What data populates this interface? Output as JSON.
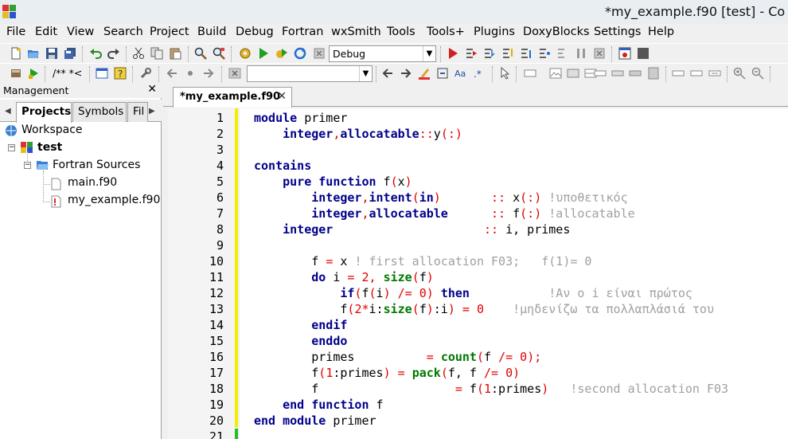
{
  "window": {
    "title": "*my_example.f90 [test] - Co"
  },
  "menu": [
    "File",
    "Edit",
    "View",
    "Search",
    "Project",
    "Build",
    "Debug",
    "Fortran",
    "wxSmith",
    "Tools",
    "Tools+",
    "Plugins",
    "DoxyBlocks",
    "Settings",
    "Help"
  ],
  "toolbar": {
    "build_target": "Debug",
    "doxy_comment_label": "/** *<",
    "search_value": ""
  },
  "management": {
    "title": "Management",
    "close": "✕",
    "tabs": [
      "Projects",
      "Symbols",
      "Fil"
    ],
    "tree": {
      "workspace": "Workspace",
      "project": "test",
      "folder": "Fortran Sources",
      "files": [
        "main.f90",
        "my_example.f90"
      ]
    }
  },
  "editor": {
    "tab_label": "*my_example.f90",
    "tab_close": "✕",
    "lines": [
      {
        "n": "1",
        "tokens": [
          [
            "kw",
            "module"
          ],
          [
            "id",
            " primer"
          ]
        ]
      },
      {
        "n": "2",
        "tokens": [
          [
            "id",
            "    "
          ],
          [
            "kw",
            "integer"
          ],
          [
            "op",
            ","
          ],
          [
            "kw",
            "allocatable"
          ],
          [
            "op",
            "::"
          ],
          [
            "id",
            "y"
          ],
          [
            "op",
            "(:)"
          ]
        ]
      },
      {
        "n": "3",
        "tokens": []
      },
      {
        "n": "4",
        "tokens": [
          [
            "kw",
            "contains"
          ]
        ]
      },
      {
        "n": "5",
        "tokens": [
          [
            "id",
            "    "
          ],
          [
            "kw",
            "pure function"
          ],
          [
            "id",
            " f"
          ],
          [
            "op",
            "("
          ],
          [
            "id",
            "x"
          ],
          [
            "op",
            ")"
          ]
        ]
      },
      {
        "n": "6",
        "tokens": [
          [
            "id",
            "        "
          ],
          [
            "kw",
            "integer"
          ],
          [
            "op",
            ","
          ],
          [
            "kw",
            "intent"
          ],
          [
            "op",
            "("
          ],
          [
            "kw",
            "in"
          ],
          [
            "op",
            ")"
          ],
          [
            "id",
            "       "
          ],
          [
            "op",
            "::"
          ],
          [
            "id",
            " x"
          ],
          [
            "op",
            "(:)"
          ],
          [
            "cm",
            " !υποθετικός"
          ]
        ]
      },
      {
        "n": "7",
        "tokens": [
          [
            "id",
            "        "
          ],
          [
            "kw",
            "integer"
          ],
          [
            "op",
            ","
          ],
          [
            "kw",
            "allocatable"
          ],
          [
            "id",
            "      "
          ],
          [
            "op",
            "::"
          ],
          [
            "id",
            " f"
          ],
          [
            "op",
            "(:)"
          ],
          [
            "cm",
            " !allocatable"
          ]
        ]
      },
      {
        "n": "8",
        "tokens": [
          [
            "id",
            "    "
          ],
          [
            "kw",
            "integer"
          ],
          [
            "id",
            "                     "
          ],
          [
            "op",
            "::"
          ],
          [
            "id",
            " i, primes"
          ]
        ]
      },
      {
        "n": "9",
        "tokens": []
      },
      {
        "n": "10",
        "tokens": [
          [
            "id",
            "        f "
          ],
          [
            "op",
            "="
          ],
          [
            "id",
            " x "
          ],
          [
            "cm",
            "! first allocation F03;   f(1)= 0"
          ]
        ]
      },
      {
        "n": "11",
        "tokens": [
          [
            "id",
            "        "
          ],
          [
            "kw",
            "do"
          ],
          [
            "id",
            " i "
          ],
          [
            "op",
            "="
          ],
          [
            "num",
            " 2"
          ],
          [
            "op",
            ","
          ],
          [
            "id",
            " "
          ],
          [
            "fn",
            "size"
          ],
          [
            "op",
            "("
          ],
          [
            "id",
            "f"
          ],
          [
            "op",
            ")"
          ]
        ]
      },
      {
        "n": "12",
        "tokens": [
          [
            "id",
            "            "
          ],
          [
            "kw",
            "if"
          ],
          [
            "op",
            "("
          ],
          [
            "id",
            "f"
          ],
          [
            "op",
            "("
          ],
          [
            "id",
            "i"
          ],
          [
            "op",
            ")"
          ],
          [
            "id",
            " "
          ],
          [
            "op",
            "/="
          ],
          [
            "num",
            " 0"
          ],
          [
            "op",
            ")"
          ],
          [
            "id",
            " "
          ],
          [
            "kw",
            "then"
          ],
          [
            "id",
            "           "
          ],
          [
            "cm",
            "!Αν ο i είναι πρώτος"
          ]
        ]
      },
      {
        "n": "13",
        "tokens": [
          [
            "id",
            "            f"
          ],
          [
            "op",
            "("
          ],
          [
            "num",
            "2"
          ],
          [
            "op",
            "*"
          ],
          [
            "id",
            "i:"
          ],
          [
            "fn",
            "size"
          ],
          [
            "op",
            "("
          ],
          [
            "id",
            "f"
          ],
          [
            "op",
            ")"
          ],
          [
            "id",
            ":i"
          ],
          [
            "op",
            ")"
          ],
          [
            "id",
            " "
          ],
          [
            "op",
            "="
          ],
          [
            "num",
            " 0"
          ],
          [
            "id",
            "    "
          ],
          [
            "cm",
            "!μηδενίζω τα πολλαπλάσιά του"
          ]
        ]
      },
      {
        "n": "14",
        "tokens": [
          [
            "id",
            "        "
          ],
          [
            "kw",
            "endif"
          ]
        ]
      },
      {
        "n": "15",
        "tokens": [
          [
            "id",
            "        "
          ],
          [
            "kw",
            "enddo"
          ]
        ]
      },
      {
        "n": "16",
        "tokens": [
          [
            "id",
            "        primes          "
          ],
          [
            "op",
            "="
          ],
          [
            "id",
            " "
          ],
          [
            "fn",
            "count"
          ],
          [
            "op",
            "("
          ],
          [
            "id",
            "f "
          ],
          [
            "op",
            "/="
          ],
          [
            "num",
            " 0"
          ],
          [
            "op",
            ");"
          ]
        ]
      },
      {
        "n": "17",
        "tokens": [
          [
            "id",
            "        f"
          ],
          [
            "op",
            "("
          ],
          [
            "num",
            "1"
          ],
          [
            "id",
            ":primes"
          ],
          [
            "op",
            ")"
          ],
          [
            "id",
            " "
          ],
          [
            "op",
            "="
          ],
          [
            "id",
            " "
          ],
          [
            "fn",
            "pack"
          ],
          [
            "op",
            "("
          ],
          [
            "id",
            "f, f "
          ],
          [
            "op",
            "/="
          ],
          [
            "num",
            " 0"
          ],
          [
            "op",
            ")"
          ]
        ]
      },
      {
        "n": "18",
        "tokens": [
          [
            "id",
            "        f                   "
          ],
          [
            "op",
            "="
          ],
          [
            "id",
            " f"
          ],
          [
            "op",
            "("
          ],
          [
            "num",
            "1"
          ],
          [
            "id",
            ":primes"
          ],
          [
            "op",
            ")"
          ],
          [
            "id",
            "   "
          ],
          [
            "cm",
            "!second allocation F03"
          ]
        ]
      },
      {
        "n": "19",
        "tokens": [
          [
            "id",
            "    "
          ],
          [
            "kw",
            "end function"
          ],
          [
            "id",
            " f"
          ]
        ]
      },
      {
        "n": "20",
        "tokens": [
          [
            "kw",
            "end module"
          ],
          [
            "id",
            " primer"
          ]
        ]
      },
      {
        "n": "21",
        "tokens": []
      }
    ]
  }
}
